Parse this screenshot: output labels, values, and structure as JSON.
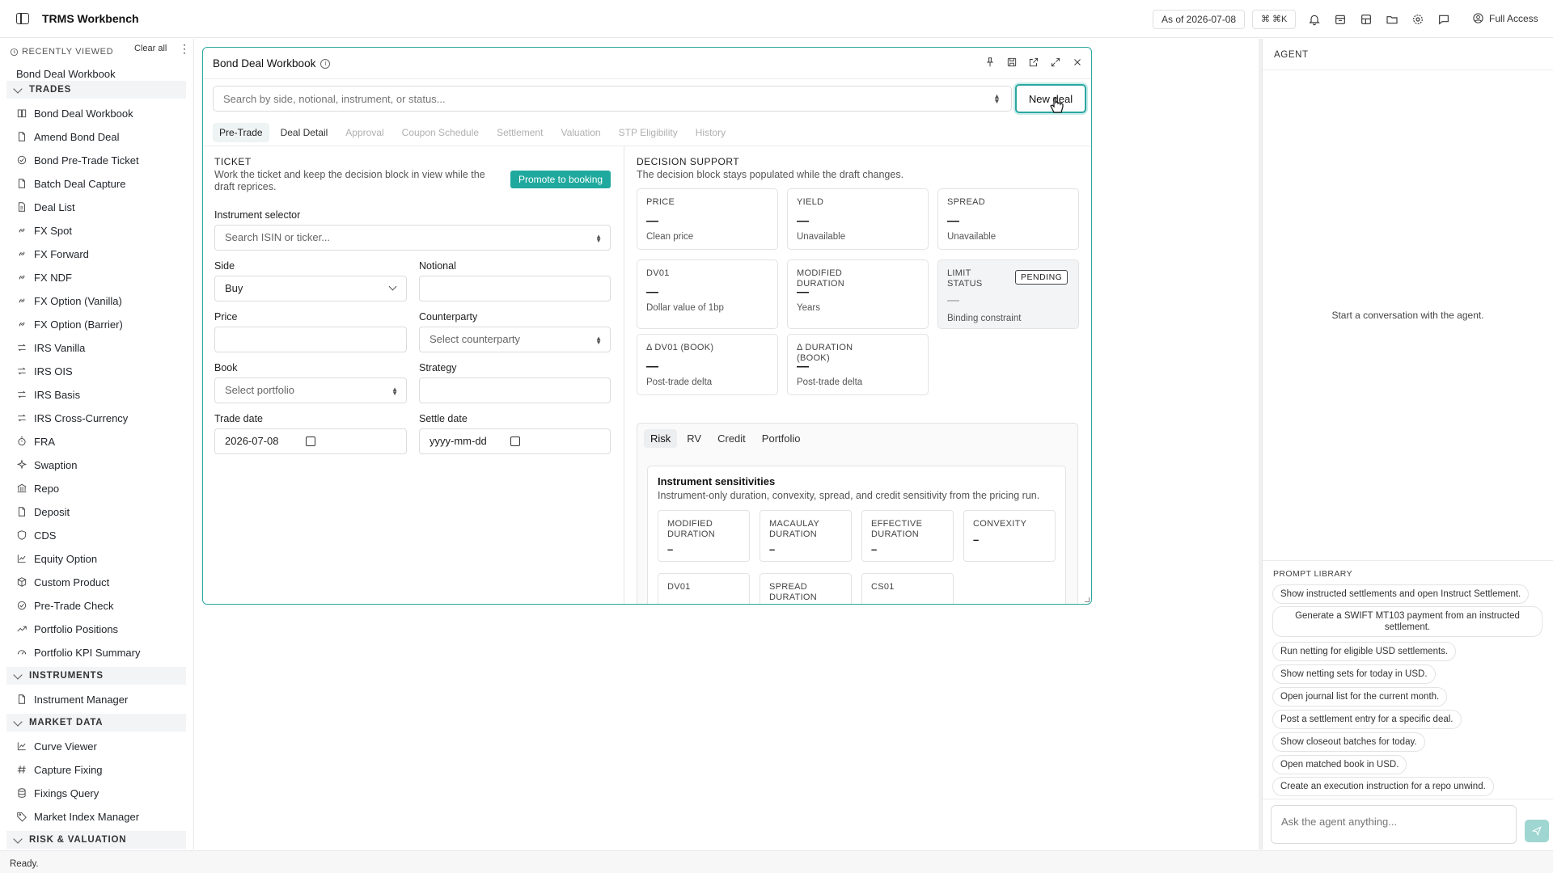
{
  "topbar": {
    "title": "TRMS Workbench",
    "as_of": "As of 2026-07-08",
    "shortcut": "⌘ ⌘K",
    "access": "Full Access"
  },
  "sidebar": {
    "recently_viewed_label": "RECENTLY VIEWED",
    "clear_all": "Clear all",
    "recent_items": [
      "Bond Deal Workbook"
    ],
    "sections": [
      {
        "label": "TRADES",
        "items": [
          {
            "label": "Bond Deal Workbook",
            "icon": "book-icon"
          },
          {
            "label": "Amend Bond Deal",
            "icon": "file-icon"
          },
          {
            "label": "Bond Pre-Trade Ticket",
            "icon": "check-circle-icon"
          },
          {
            "label": "Batch Deal Capture",
            "icon": "file-icon"
          },
          {
            "label": "Deal List",
            "icon": "file-text-icon"
          },
          {
            "label": "FX Spot",
            "icon": "link-icon"
          },
          {
            "label": "FX Forward",
            "icon": "link-icon"
          },
          {
            "label": "FX NDF",
            "icon": "link-icon"
          },
          {
            "label": "FX Option (Vanilla)",
            "icon": "link-icon"
          },
          {
            "label": "FX Option (Barrier)",
            "icon": "link-icon"
          },
          {
            "label": "IRS Vanilla",
            "icon": "swap-icon"
          },
          {
            "label": "IRS OIS",
            "icon": "swap-icon"
          },
          {
            "label": "IRS Basis",
            "icon": "swap-icon"
          },
          {
            "label": "IRS Cross-Currency",
            "icon": "swap-icon"
          },
          {
            "label": "FRA",
            "icon": "timer-icon"
          },
          {
            "label": "Swaption",
            "icon": "sparkle-icon"
          },
          {
            "label": "Repo",
            "icon": "bank-icon"
          },
          {
            "label": "Deposit",
            "icon": "file-icon"
          },
          {
            "label": "CDS",
            "icon": "shield-icon"
          },
          {
            "label": "Equity Option",
            "icon": "chart-line-icon"
          },
          {
            "label": "Custom Product",
            "icon": "package-icon"
          },
          {
            "label": "Pre-Trade Check",
            "icon": "check-circle-icon"
          },
          {
            "label": "Portfolio Positions",
            "icon": "trend-icon"
          },
          {
            "label": "Portfolio KPI Summary",
            "icon": "gauge-icon"
          }
        ]
      },
      {
        "label": "INSTRUMENTS",
        "items": [
          {
            "label": "Instrument Manager",
            "icon": "file-icon"
          }
        ]
      },
      {
        "label": "MARKET DATA",
        "items": [
          {
            "label": "Curve Viewer",
            "icon": "chart-line-icon"
          },
          {
            "label": "Capture Fixing",
            "icon": "hash-icon"
          },
          {
            "label": "Fixings Query",
            "icon": "database-icon"
          },
          {
            "label": "Market Index Manager",
            "icon": "tag-icon"
          }
        ]
      },
      {
        "label": "RISK & VALUATION",
        "items": []
      }
    ]
  },
  "workbook": {
    "title": "Bond Deal Workbook",
    "search_placeholder": "Search by side, notional, instrument, or status...",
    "new_deal": "New deal",
    "tabs": [
      "Pre-Trade",
      "Deal Detail",
      "Approval",
      "Coupon Schedule",
      "Settlement",
      "Valuation",
      "STP Eligibility",
      "History"
    ],
    "ticket": {
      "heading": "TICKET",
      "description": "Work the ticket and keep the decision block in view while the draft reprices.",
      "promote": "Promote to booking",
      "instrument_label": "Instrument selector",
      "instrument_placeholder": "Search ISIN or ticker...",
      "side_label": "Side",
      "side_value": "Buy",
      "notional_label": "Notional",
      "price_label": "Price",
      "counterparty_label": "Counterparty",
      "counterparty_placeholder": "Select counterparty",
      "book_label": "Book",
      "book_placeholder": "Select portfolio",
      "strategy_label": "Strategy",
      "trade_date_label": "Trade date",
      "trade_date_value": "2026-07-08",
      "settle_date_label": "Settle date",
      "settle_date_placeholder": "yyyy-mm-dd"
    },
    "decision": {
      "heading": "DECISION SUPPORT",
      "description": "The decision block stays populated while the draft changes.",
      "cards": [
        {
          "label": "PRICE",
          "value": "—",
          "sub": "Clean price"
        },
        {
          "label": "YIELD",
          "value": "—",
          "sub": "Unavailable"
        },
        {
          "label": "SPREAD",
          "value": "—",
          "sub": "Unavailable"
        },
        {
          "label": "DV01",
          "value": "—",
          "sub": "Dollar value of 1bp"
        },
        {
          "label": "MODIFIED DURATION",
          "value": "—",
          "sub": "Years"
        },
        {
          "label": "LIMIT STATUS",
          "value": "—",
          "sub": "Binding constraint",
          "badge": "PENDING"
        },
        {
          "label": "Δ DV01 (BOOK)",
          "value": "—",
          "sub": "Post-trade delta"
        },
        {
          "label": "Δ DURATION (BOOK)",
          "value": "—",
          "sub": "Post-trade delta"
        }
      ],
      "tabs": [
        "Risk",
        "RV",
        "Credit",
        "Portfolio"
      ],
      "sensitivities": {
        "title": "Instrument sensitivities",
        "description": "Instrument-only duration, convexity, spread, and credit sensitivity from the pricing run.",
        "metrics": [
          {
            "label": "MODIFIED DURATION",
            "value": "–"
          },
          {
            "label": "MACAULAY DURATION",
            "value": "–"
          },
          {
            "label": "EFFECTIVE DURATION",
            "value": "–"
          },
          {
            "label": "CONVEXITY",
            "value": "–"
          },
          {
            "label": "DV01",
            "value": ""
          },
          {
            "label": "SPREAD DURATION",
            "value": ""
          },
          {
            "label": "CS01",
            "value": ""
          }
        ]
      }
    }
  },
  "agent": {
    "heading": "AGENT",
    "empty": "Start a conversation with the agent.",
    "prompt_library_label": "PROMPT LIBRARY",
    "prompts": [
      "Show instructed settlements and open Instruct Settlement.",
      "Generate a SWIFT MT103 payment from an instructed settlement.",
      "Run netting for eligible USD settlements.",
      "Show netting sets for today in USD.",
      "Open journal list for the current month.",
      "Post a settlement entry for a specific deal.",
      "Show closeout batches for today.",
      "Open matched book in USD.",
      "Create an execution instruction for a repo unwind."
    ],
    "input_placeholder": "Ask the agent anything..."
  },
  "status": {
    "text": "Ready."
  },
  "colors": {
    "accent": "#1fa99e",
    "panel_border": "#2aa7a0"
  }
}
